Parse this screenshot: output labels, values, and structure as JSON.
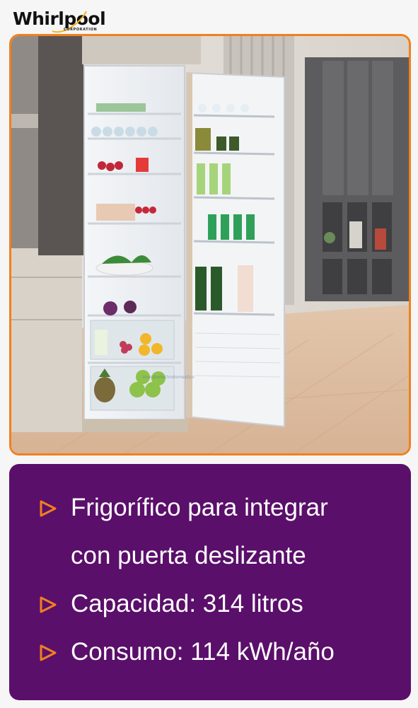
{
  "brand": {
    "logo_text": "Whirlpool",
    "logo_subtext": "CORPORATION"
  },
  "photo": {
    "subject": "built-in refrigerator with open door",
    "watermark": "mundoelectrodomestico"
  },
  "features": [
    {
      "icon": "triangle-arrow-icon",
      "lines": [
        "Frigorífico para integrar",
        "con puerta deslizante"
      ]
    },
    {
      "icon": "triangle-arrow-icon",
      "lines": [
        "Capacidad: 314 litros"
      ]
    },
    {
      "icon": "triangle-arrow-icon",
      "lines": [
        "Consumo: 114 kWh/año"
      ]
    }
  ],
  "colors": {
    "accent": "#f0801e",
    "panel": "#5a0f6a",
    "text": "#ffffff"
  }
}
